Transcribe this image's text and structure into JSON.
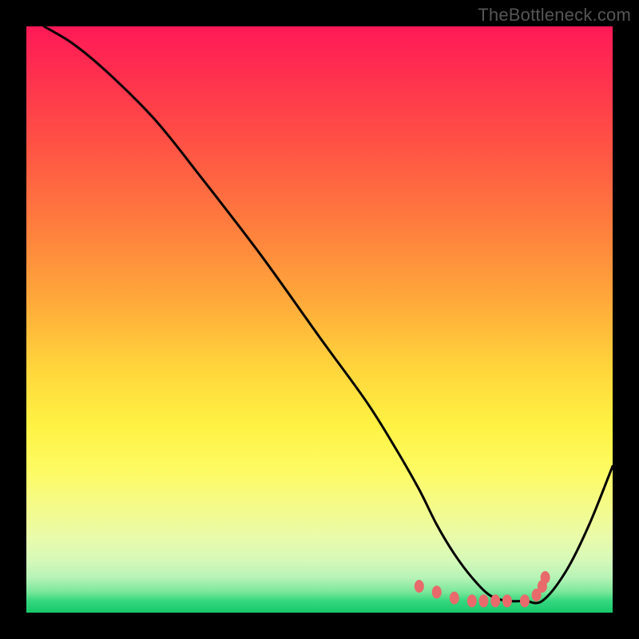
{
  "watermark": "TheBottleneck.com",
  "chart_data": {
    "type": "line",
    "title": "",
    "xlabel": "",
    "ylabel": "",
    "xlim": [
      0,
      100
    ],
    "ylim": [
      0,
      100
    ],
    "grid": false,
    "curve": {
      "x": [
        3,
        8,
        14,
        22,
        30,
        40,
        50,
        58,
        63,
        67,
        70,
        73,
        76,
        79,
        82,
        85,
        88,
        92,
        96,
        100
      ],
      "y": [
        100,
        97,
        92,
        84,
        74,
        61,
        47,
        36,
        28,
        21,
        15,
        10,
        6,
        3,
        2,
        2,
        2,
        7,
        15,
        25
      ]
    },
    "marker_points": {
      "x": [
        67,
        70,
        73,
        76,
        78,
        80,
        82,
        85,
        87,
        88,
        88.5
      ],
      "y": [
        4.5,
        3.5,
        2.5,
        2,
        2,
        2,
        2,
        2,
        3,
        4.5,
        6
      ]
    },
    "colors": {
      "curve": "#000000",
      "markers": "#e86a6a",
      "gradient_top": "#ff1a57",
      "gradient_mid": "#ffd43b",
      "gradient_bottom": "#18c96b"
    }
  }
}
